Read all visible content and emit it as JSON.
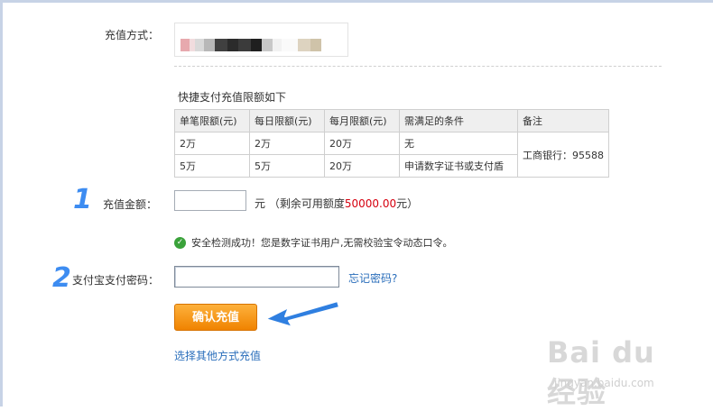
{
  "form": {
    "method_label": "充值方式：",
    "limits_title": "快捷支付充值限额如下",
    "step1": "1",
    "step2": "2",
    "amount_label": "充值金额：",
    "unit_prefix": "元 （剩余可用额度",
    "remaining_amount": "50000.00",
    "unit_suffix": "元）",
    "security_text": "安全检测成功！您是数字证书用户,无需校验宝令动态口令。",
    "pwd_label": "支付宝支付密码：",
    "forgot_link": "忘记密码?",
    "confirm_button": "确认充值",
    "other_method_link": "选择其他方式充值"
  },
  "limits_table": {
    "headers": [
      "单笔限额(元)",
      "每日限额(元)",
      "每月限额(元)",
      "需满足的条件",
      "备注"
    ],
    "rows": [
      [
        "2万",
        "2万",
        "20万",
        "无"
      ],
      [
        "5万",
        "5万",
        "20万",
        "申请数字证书或支付盾"
      ]
    ],
    "remark": "工商银行：95588"
  },
  "watermark": {
    "big": "Bai du 经验",
    "small": "jingyan.baidu.com"
  },
  "colors": {
    "accent_button": "#f08300",
    "link": "#2a6ebb",
    "highlight_red": "#d6000f",
    "step_number": "#3d8cf1",
    "success_icon": "#3aa23a"
  },
  "icons": {
    "success": "check-circle-icon",
    "arrow": "arrow-annotation-icon"
  }
}
